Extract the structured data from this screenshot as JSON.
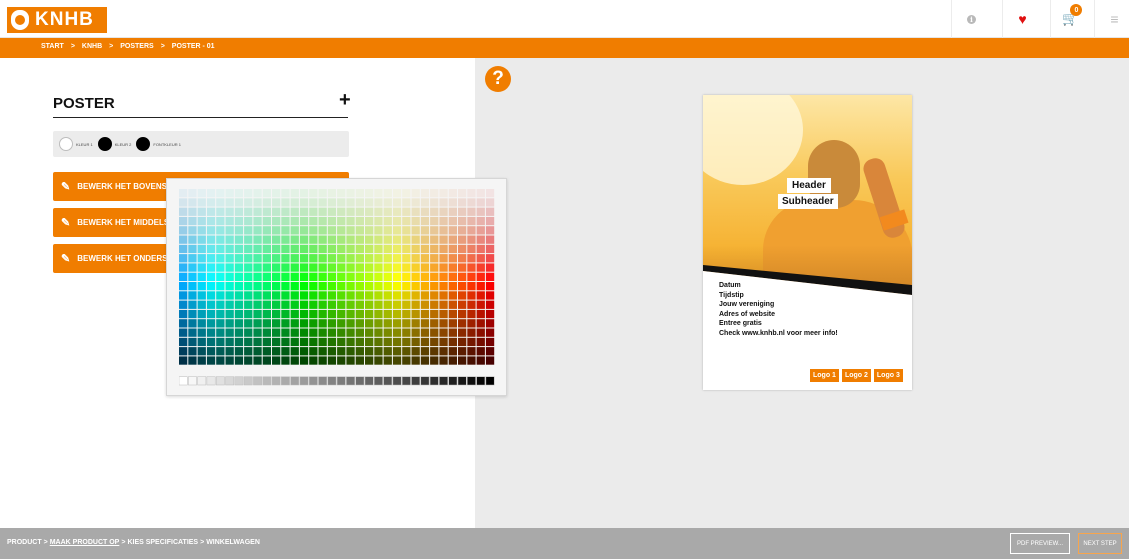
{
  "brand": {
    "name": "KNHB",
    "accent": "#f07d00"
  },
  "header": {
    "icons": [
      "info-icon",
      "heart-icon",
      "cart-icon",
      "menu-icon"
    ],
    "info_glyph": "i",
    "cart_count": "0"
  },
  "breadcrumb": [
    "START",
    ">",
    "KNHB",
    ">",
    "POSTERS",
    ">",
    "POSTER - 01"
  ],
  "editor": {
    "title": "POSTER",
    "add_symbol": "+",
    "colors": [
      {
        "label": "KLEUR 1",
        "value": "#ffffff"
      },
      {
        "label": "KLEUR 2",
        "value": "#000000"
      },
      {
        "label": "FONTKLEUR 1",
        "value": "#000000"
      }
    ],
    "edit_buttons": [
      "BEWERK HET BOVENST",
      "BEWERK HET MIDDELST",
      "BEWERK HET ONDERST"
    ]
  },
  "help_symbol": "?",
  "poster": {
    "header": "Header",
    "subheader": "Subheader",
    "lines": [
      "Datum",
      "Tijdstip",
      "Jouw vereniging",
      "Adres of website",
      "Entree gratis",
      "Check www.knhb.nl voor meer info!"
    ],
    "logos": [
      "Logo 1",
      "Logo 2",
      "Logo 3"
    ]
  },
  "footer": {
    "steps": [
      "PRODUCT",
      ">",
      "MAAK PRODUCT OP",
      ">",
      "KIES SPECIFICATIES",
      ">",
      "WINKELWAGEN"
    ],
    "pdf_preview": "PDF PREVIEW...",
    "next_step": "NEXT STEP"
  }
}
